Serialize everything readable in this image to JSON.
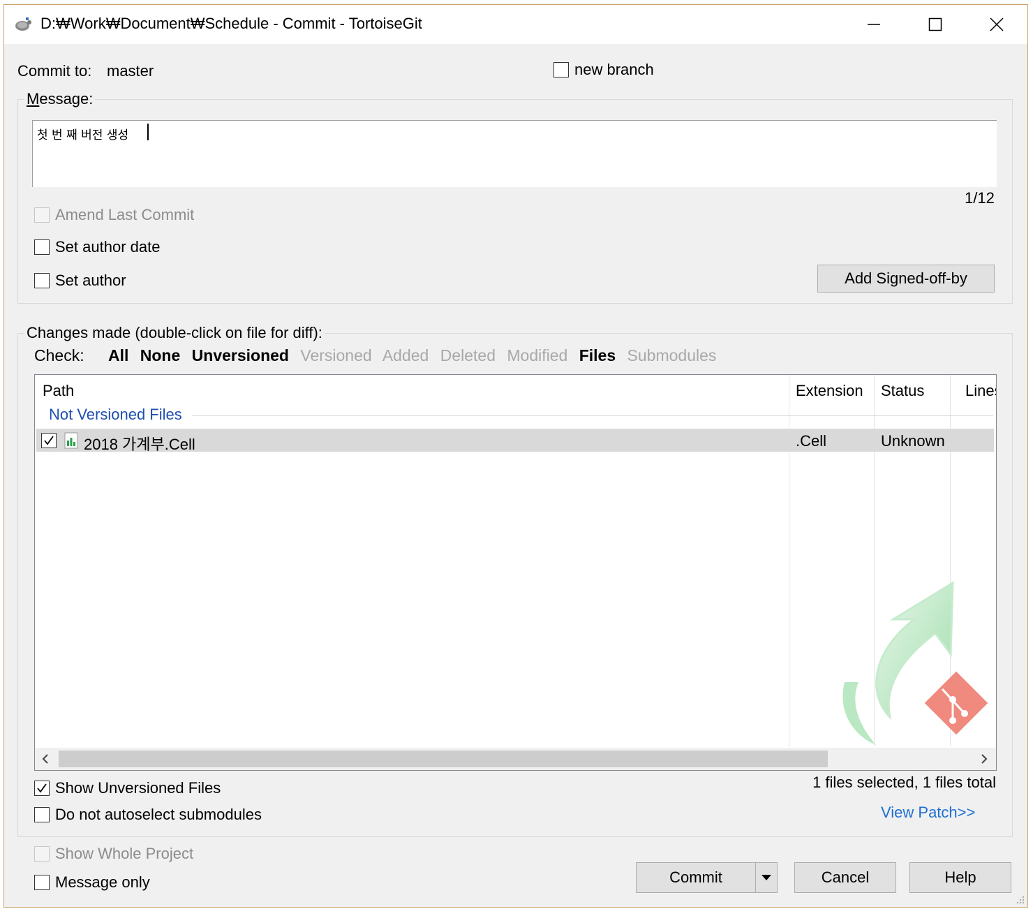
{
  "window": {
    "title": "D:₩Work₩Document₩Schedule - Commit - TortoiseGit"
  },
  "commit_to": {
    "label": "Commit to:",
    "branch": "master",
    "new_branch_label": "new branch",
    "new_branch_checked": false
  },
  "message": {
    "group_label": "Message:",
    "text": "첫 번 째 버전 생성",
    "counter": "1/12"
  },
  "options": {
    "amend_last_commit": "Amend Last Commit",
    "set_author_date": "Set author date",
    "set_author": "Set author",
    "add_signed_off_by": "Add Signed-off-by"
  },
  "changes": {
    "group_label": "Changes made (double-click on file for diff):",
    "check_label": "Check:",
    "filters": [
      {
        "label": "All",
        "enabled": true
      },
      {
        "label": "None",
        "enabled": true
      },
      {
        "label": "Unversioned",
        "enabled": true
      },
      {
        "label": "Versioned",
        "enabled": false
      },
      {
        "label": "Added",
        "enabled": false
      },
      {
        "label": "Deleted",
        "enabled": false
      },
      {
        "label": "Modified",
        "enabled": false
      },
      {
        "label": "Files",
        "enabled": true
      },
      {
        "label": "Submodules",
        "enabled": false
      }
    ],
    "columns": [
      "Path",
      "Extension",
      "Status",
      "Lines"
    ],
    "group_header": "Not Versioned Files",
    "rows": [
      {
        "checked": true,
        "path": "2018 가계부.Cell",
        "extension": ".Cell",
        "status": "Unknown",
        "lines": ""
      }
    ],
    "show_unversioned": "Show Unversioned Files",
    "show_unversioned_checked": true,
    "no_autoselect": "Do not autoselect submodules",
    "selection_summary": "1 files selected, 1 files total",
    "view_patch": "View Patch>>"
  },
  "footer": {
    "show_whole_project": "Show Whole Project",
    "message_only": "Message only",
    "commit": "Commit",
    "cancel": "Cancel",
    "help": "Help"
  },
  "colors": {
    "link": "#1e6fd0",
    "group_header": "#1e4fb0",
    "selection": "#d9d9d9"
  }
}
